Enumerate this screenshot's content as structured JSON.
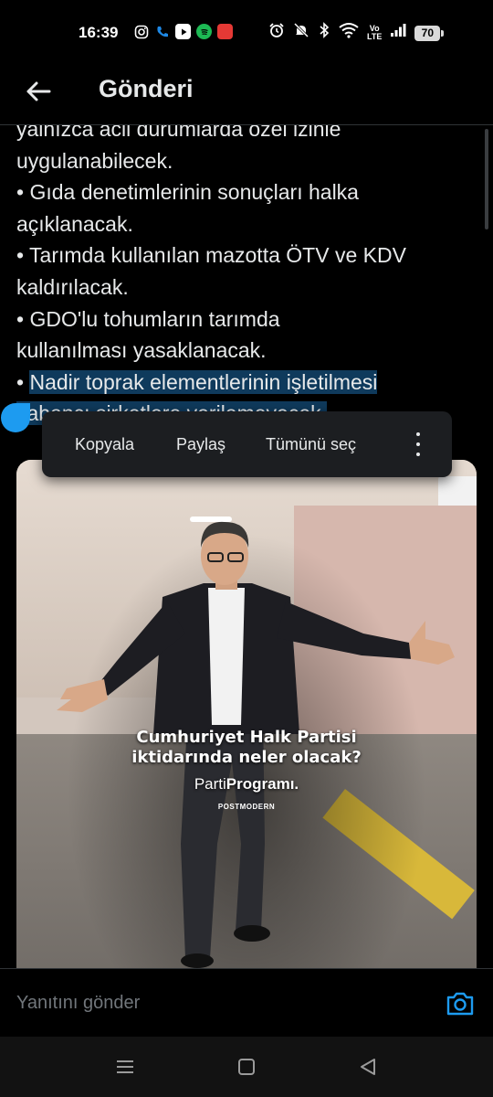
{
  "status_bar": {
    "time": "16:39",
    "volte_top": "Vo",
    "volte_bottom": "LTE",
    "battery": "70",
    "left_icons": [
      "instagram-icon",
      "phone-icon",
      "youtube-icon",
      "spotify-icon",
      "app-icon"
    ],
    "right_icons": [
      "alarm-icon",
      "mute-icon",
      "bluetooth-icon",
      "wifi-icon",
      "signal-icon",
      "battery-icon"
    ]
  },
  "header": {
    "title": "Gönderi"
  },
  "post": {
    "lines": [
      "yalnızca acil durumlarda özel izinle",
      "uygulanabilecek.",
      "• Gıda denetimlerinin sonuçları halka",
      "açıklanacak.",
      "• Tarımda kullanılan mazotta ÖTV ve KDV",
      "kaldırılacak.",
      "• GDO'lu tohumların tarımda",
      "kullanılması yasaklanacak."
    ],
    "bullet": "• ",
    "selected_line_1": "Nadir toprak elementlerinin işletilmesi",
    "selected_line_2": "yabancı şirketlere verilemeyecek."
  },
  "context_menu": {
    "copy": "Kopyala",
    "share": "Paylaş",
    "select_all": "Tümünü seç"
  },
  "media": {
    "title_line_1": "Cumhuriyet Halk Partisi",
    "title_line_2": "iktidarında neler olacak?",
    "brand_light": "Parti",
    "brand_bold": "Programı.",
    "small_label": "POSTMODERN"
  },
  "reply": {
    "placeholder": "Yanıtını gönder"
  },
  "nav_bar": {
    "icons": [
      "menu-icon",
      "home-icon",
      "back-triangle-icon"
    ]
  },
  "colors": {
    "accent": "#1d9bf0",
    "selection": "#0f3a5c",
    "text": "#e7e9ea",
    "muted": "#71767b"
  }
}
